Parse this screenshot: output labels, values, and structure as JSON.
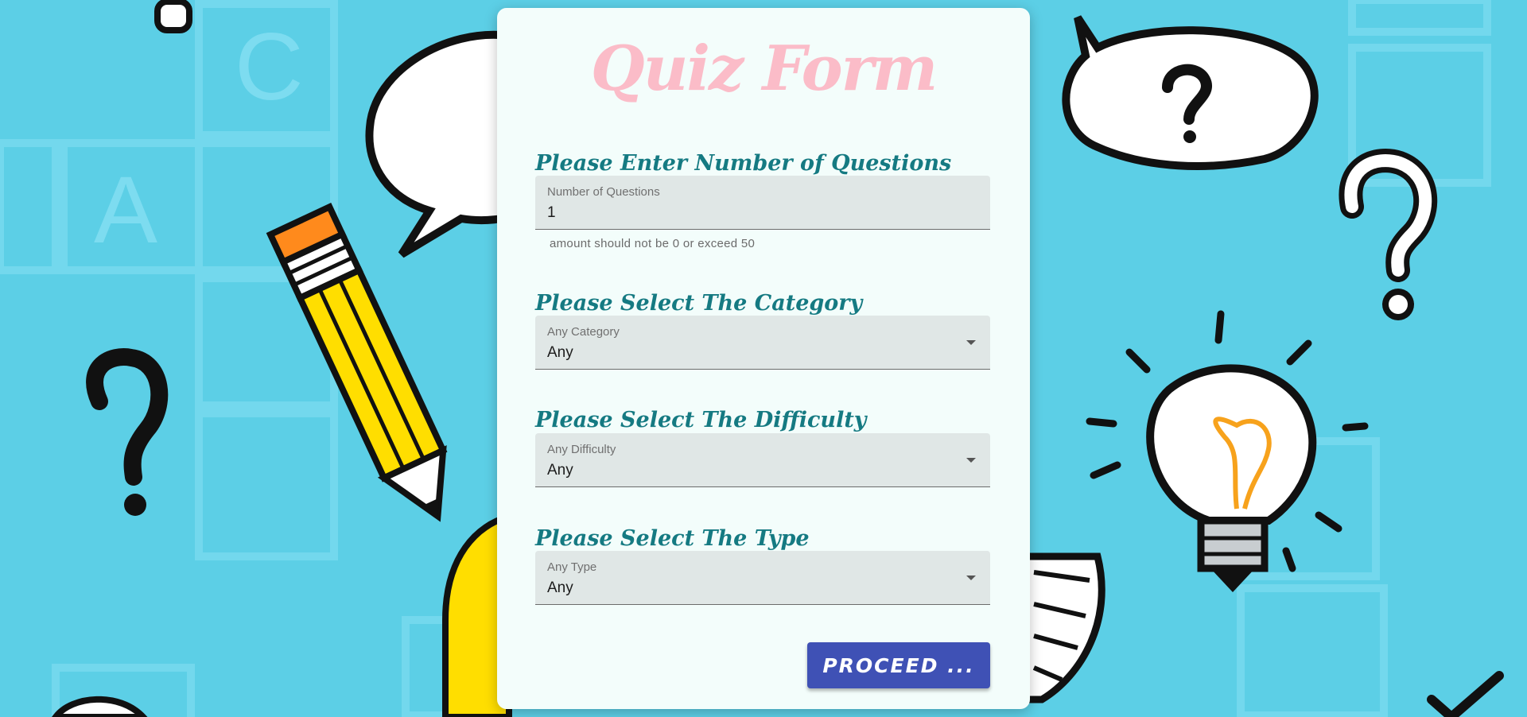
{
  "form": {
    "title": "Quiz Form",
    "questions": {
      "heading": "Please Enter Number of Questions",
      "label": "Number of Questions",
      "value": "1",
      "helper": "amount should not be 0 or exceed 50"
    },
    "category": {
      "heading": "Please Select The Category",
      "label": "Any Category",
      "value": "Any"
    },
    "difficulty": {
      "heading": "Please Select The Difficulty",
      "label": "Any Difficulty",
      "value": "Any"
    },
    "type": {
      "heading": "Please Select The Type",
      "label": "Any Type",
      "value": "Any"
    },
    "proceed_label": "PROCEED ..."
  },
  "colors": {
    "background": "#5ccfe6",
    "card": "#f3fdfb",
    "title": "#fbbcc8",
    "heading": "#157a82",
    "button": "#3f51b5"
  },
  "background_art": {
    "letters": [
      "C",
      "A"
    ],
    "icons": [
      "pencil",
      "speech-bubble",
      "question-mark",
      "lightbulb",
      "checkmark"
    ]
  }
}
